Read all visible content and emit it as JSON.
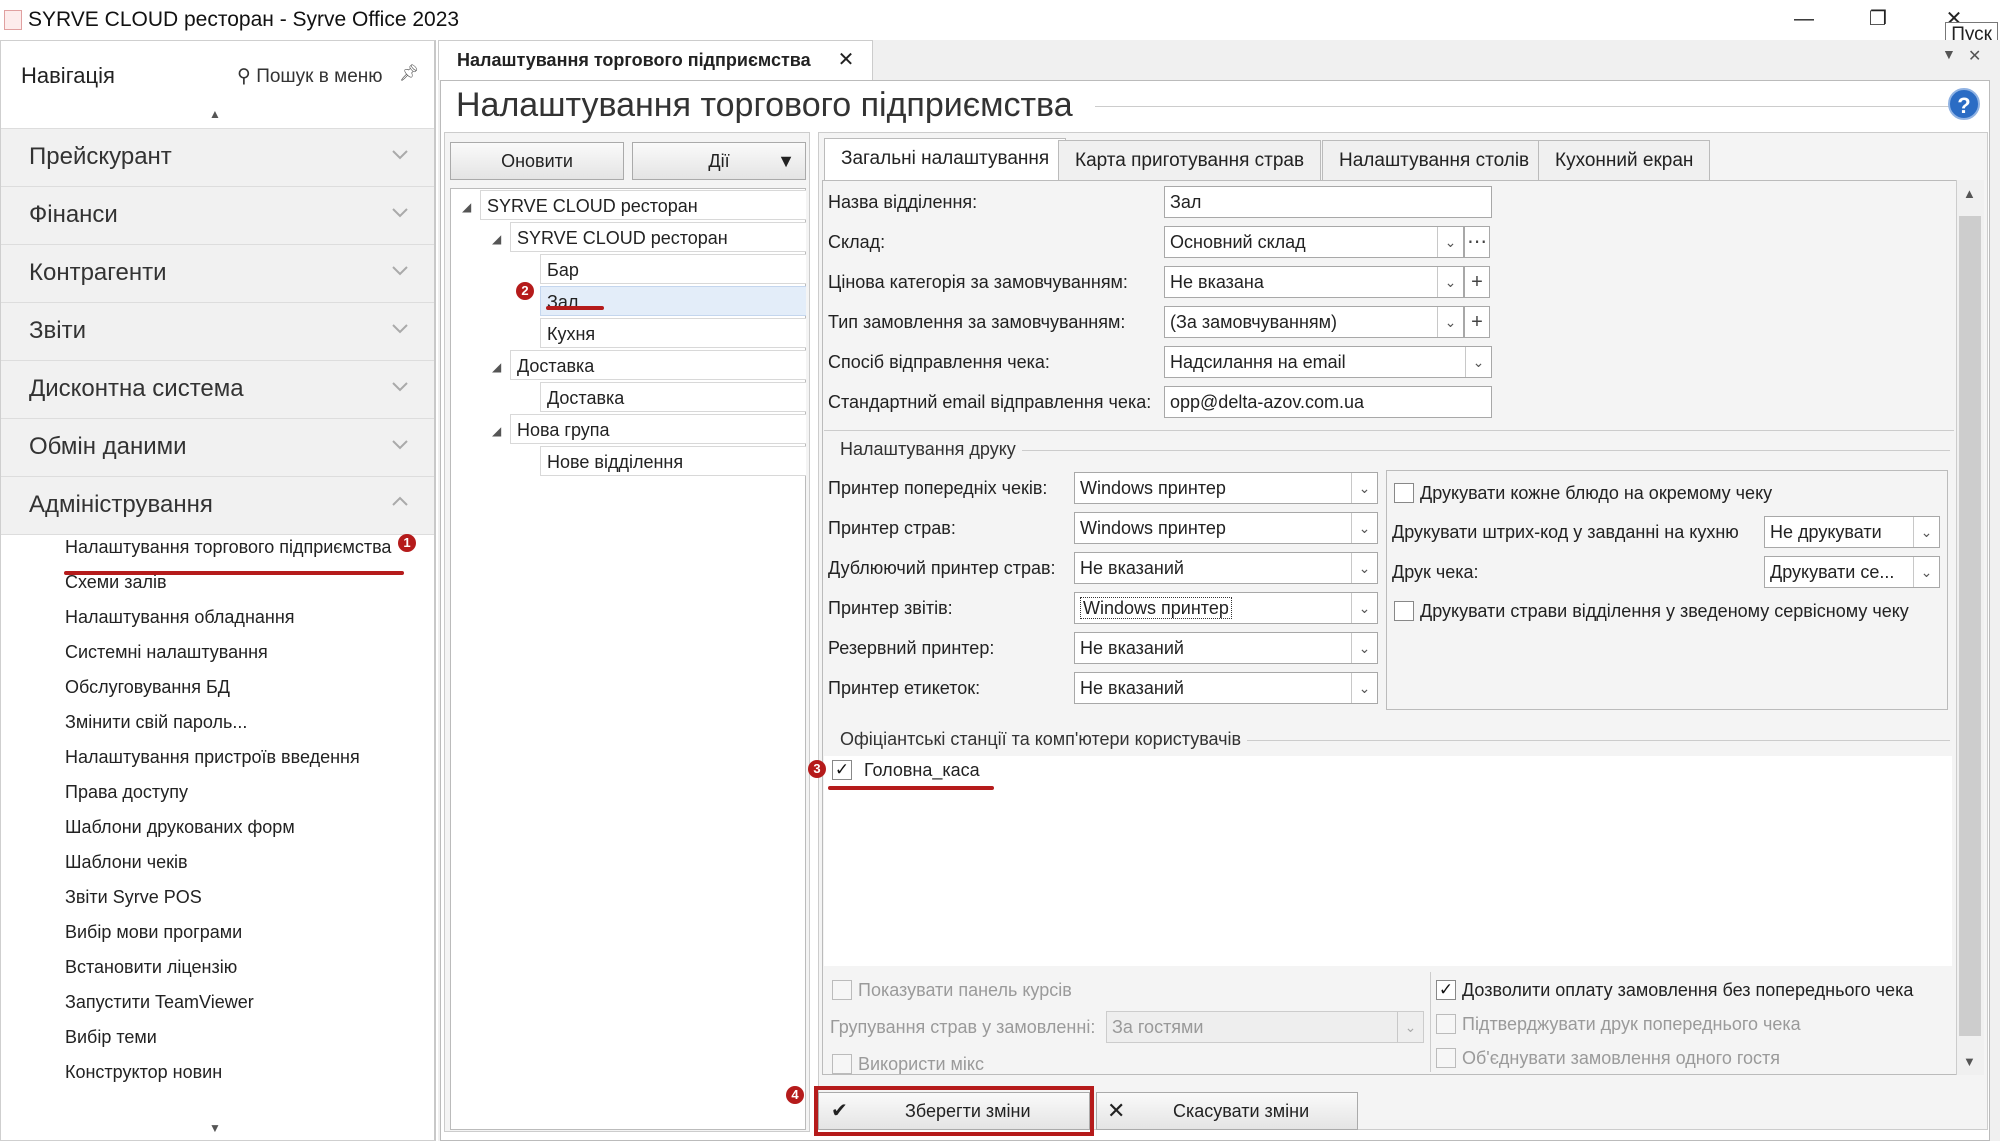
{
  "window": {
    "title": "SYRVE CLOUD ресторан - Syrve Office 2023",
    "minimize": "—",
    "restore": "❐",
    "close": "✕",
    "tooltip": "Пуск"
  },
  "nav": {
    "title": "Навігація",
    "search": "Пошук в меню",
    "sections": [
      {
        "label": "Прейскурант"
      },
      {
        "label": "Фінанси"
      },
      {
        "label": "Контрагенти"
      },
      {
        "label": "Звіти"
      },
      {
        "label": "Дисконтна система"
      },
      {
        "label": "Обмін даними"
      },
      {
        "label": "Адміністрування"
      }
    ],
    "sub_items": [
      "Налаштування торгового підприємства",
      "Схеми залів",
      "Налаштування обладнання",
      "Системні налаштування",
      "Обслуговування БД",
      "Змінити свій пароль...",
      "Налаштування пристроїв введення",
      "Права доступу",
      "Шаблони друкованих форм",
      "Шаблони чеків",
      "Звіти Syrve POS",
      "Вибір мови програми",
      "Встановити ліцензію",
      "Запустити TeamViewer",
      "Вибір теми",
      "Конструктор новин"
    ]
  },
  "doc_tab": {
    "label": "Налаштування торгового підприємства",
    "close": "✕"
  },
  "page_title": "Налаштування торгового підприємства",
  "help": "?",
  "tree_panel": {
    "refresh": "Оновити",
    "actions": "Дії",
    "items": [
      "SYRVE CLOUD ресторан",
      "SYRVE CLOUD ресторан",
      "Бар",
      "Зал",
      "Кухня",
      "Доставка",
      "Доставка",
      "Нова група",
      "Нове відділення"
    ]
  },
  "tabs": [
    "Загальні налаштування",
    "Карта приготування страв",
    "Налаштування столів",
    "Кухонний екран"
  ],
  "general": {
    "dept_name_label": "Назва відділення:",
    "dept_name": "Зал",
    "store_label": "Склад:",
    "store": "Основний склад",
    "price_cat_label": "Цінова категорія за замовчуванням:",
    "price_cat": "Не вказана",
    "order_type_label": "Тип замовлення за замовчуванням:",
    "order_type": "(За замовчуванням)",
    "receipt_method_label": "Спосіб відправлення чека:",
    "receipt_method": "Надсилання на email",
    "email_label": "Стандартний email відправлення чека:",
    "email": "opp@delta-azov.com.ua"
  },
  "print": {
    "group_title": "Налаштування друку",
    "precheck_printer_label": "Принтер попередніх чеків:",
    "precheck_printer": "Windows принтер",
    "dish_printer_label": "Принтер страв:",
    "dish_printer": "Windows принтер",
    "dup_printer_label": "Дублюючий принтер страв:",
    "dup_printer": "Не вказаний",
    "report_printer_label": "Принтер звітів:",
    "report_printer": "Windows принтер",
    "reserve_printer_label": "Резервний принтер:",
    "reserve_printer": "Не вказаний",
    "label_printer_label": "Принтер етикеток:",
    "label_printer": "Не вказаний",
    "each_dish_label": "Друкувати кожне блюдо на окремому чеку",
    "barcode_label": "Друкувати штрих-код у завданні на кухню",
    "barcode": "Не друкувати",
    "receipt_print_label": "Друк чека:",
    "receipt_print": "Друкувати се...",
    "dept_dishes_label": "Друкувати страви відділення у зведеному сервісному чеку"
  },
  "stations": {
    "group_title": "Офіціантські станції та комп'ютери користувачів",
    "items": [
      {
        "label": "Головна_каса",
        "checked": "✓"
      }
    ]
  },
  "bottom_options": {
    "show_rates": "Показувати панель курсів",
    "grouping_label": "Групування страв у замовленні:",
    "grouping": "За гостями",
    "use_mix": "Використи мікс",
    "allow_payment": "Дозволити оплату замовлення без попереднього чека",
    "allow_payment_check": "✓",
    "confirm_precheck": "Підтверджувати друк попереднього чека",
    "merge_orders": "Об'єднувати замовлення одного гостя"
  },
  "actions": {
    "save_icon": "✔",
    "save": "Зберегти зміни",
    "cancel_icon": "✕",
    "cancel": "Скасувати зміни"
  },
  "annotations": [
    "1",
    "2",
    "3",
    "4"
  ],
  "colors": {
    "annotation": "#b51b1b",
    "selection": "#e3edf9",
    "help": "#2b6cc4"
  }
}
